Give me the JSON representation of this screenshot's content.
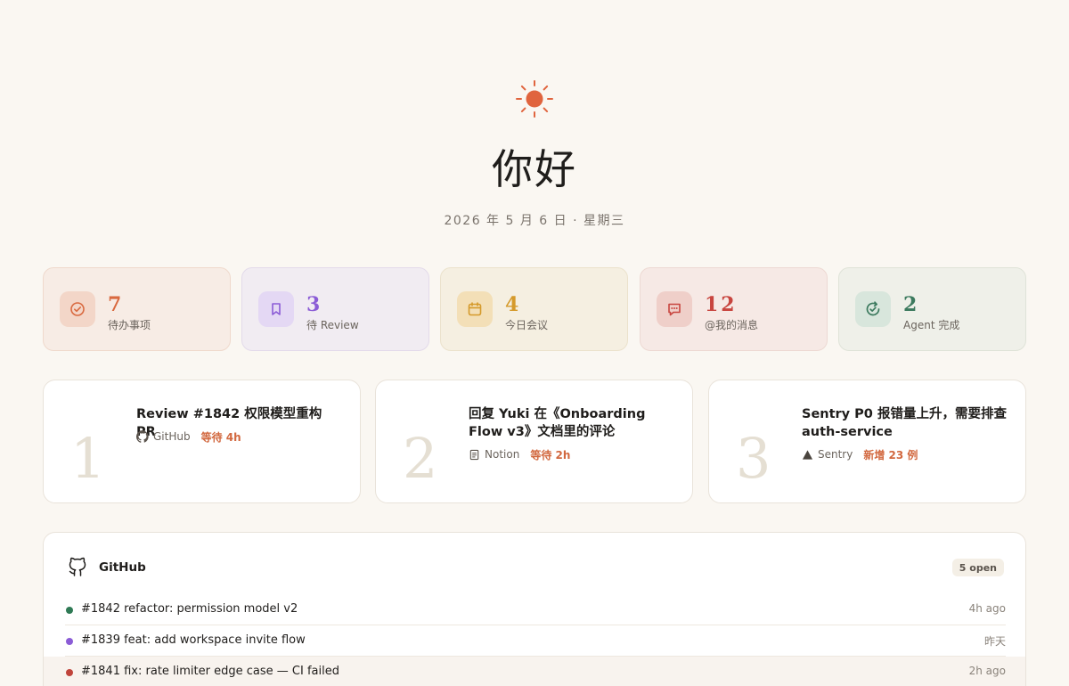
{
  "hero": {
    "greeting": "你好",
    "date": "2026 年 5 月 6 日 · 星期三",
    "icon": "sun-icon",
    "accent": "#e0643e"
  },
  "stats": [
    {
      "num": "7",
      "label": "待办事项",
      "icon": "check-circle-icon",
      "color": "#d9693f",
      "bg": "#f7ece5",
      "border": "#efd9cc",
      "ibg": "#f3d6c8"
    },
    {
      "num": "3",
      "label": "待 Review",
      "icon": "bookmark-icon",
      "color": "#8b5cd6",
      "bg": "#f1ecf2",
      "border": "#e3daea",
      "ibg": "#e4d8f4"
    },
    {
      "num": "4",
      "label": "今日会议",
      "icon": "calendar-icon",
      "color": "#d59a2b",
      "bg": "#f5efe1",
      "border": "#ebe2cc",
      "ibg": "#f3dfb7"
    },
    {
      "num": "12",
      "label": "@我的消息",
      "icon": "message-icon",
      "color": "#c8453f",
      "bg": "#f6e9e5",
      "border": "#edd9d3",
      "ibg": "#efcfc9"
    },
    {
      "num": "2",
      "label": "Agent 完成",
      "icon": "refresh-check-icon",
      "color": "#3c7a5e",
      "bg": "#eff0e9",
      "border": "#dfe3d8",
      "ibg": "#d8e6dc"
    }
  ],
  "tasks": [
    {
      "n": "1",
      "title": "Review #1842 权限模型重构 PR",
      "source": "GitHub",
      "source_icon": "github-icon",
      "wait": "等待 4h"
    },
    {
      "n": "2",
      "title": "回复 Yuki 在《Onboarding Flow v3》文档里的评论",
      "source": "Notion",
      "source_icon": "document-icon",
      "wait": "等待 2h"
    },
    {
      "n": "3",
      "title": "Sentry P0 报错量上升，需要排查 auth-service",
      "source": "Sentry",
      "source_icon": "triangle-icon",
      "wait": "新增 23 例"
    }
  ],
  "github": {
    "title": "GitHub",
    "badge": "5 open",
    "prs": [
      {
        "title": "#1842 refactor: permission model v2",
        "ago": "4h ago",
        "color": "#2f7a55"
      },
      {
        "title": "#1839 feat: add workspace invite flow",
        "ago": "昨天",
        "color": "#8b5cd6"
      },
      {
        "title": "#1841 fix: rate limiter edge case — CI failed",
        "ago": "2h ago",
        "color": "#c0443b"
      }
    ]
  }
}
